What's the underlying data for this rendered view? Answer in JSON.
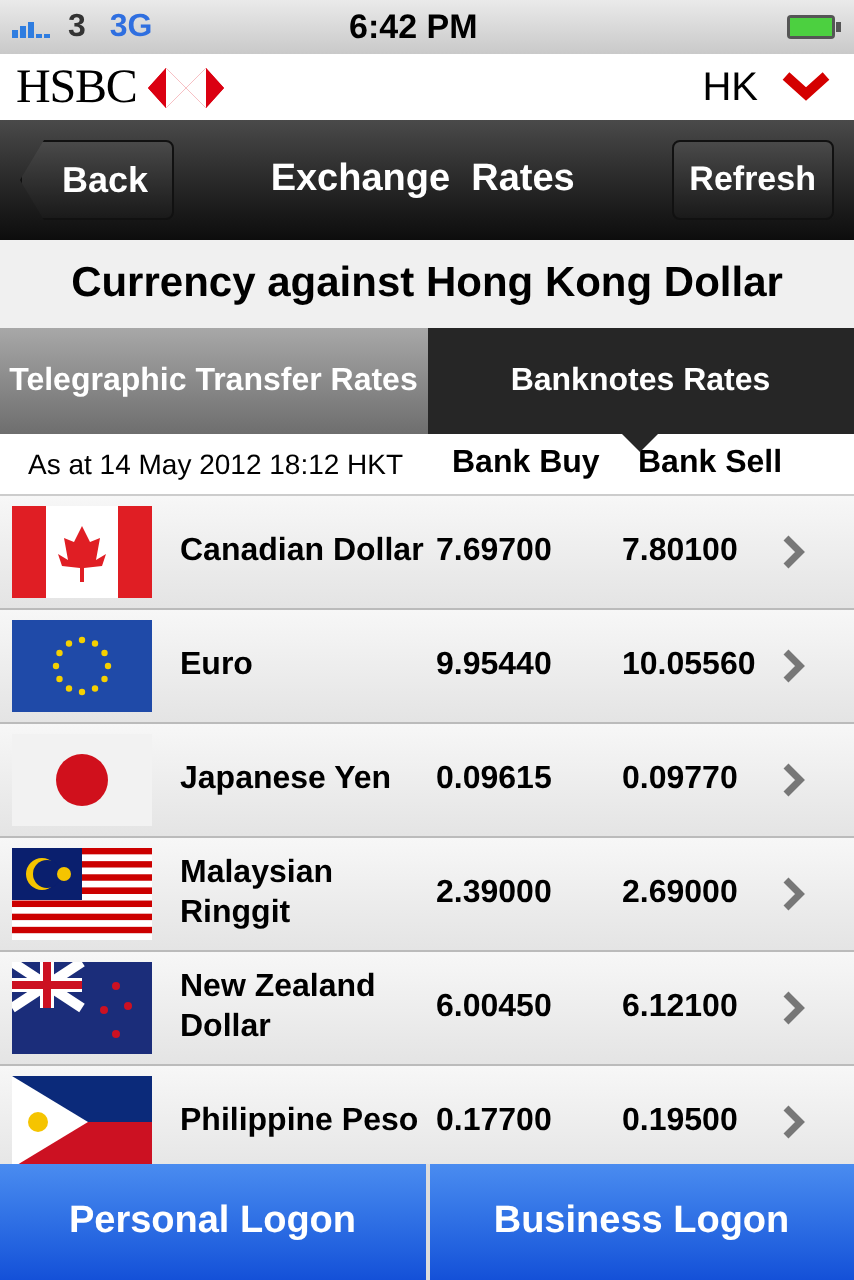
{
  "status_bar": {
    "carrier": "3",
    "network": "3G",
    "time": "6:42 PM"
  },
  "header": {
    "brand": "HSBC",
    "region": "HK"
  },
  "nav_bar": {
    "back": "Back",
    "title": "Exchange  Rates",
    "action": "Refresh"
  },
  "heading": "Currency against Hong Kong Dollar",
  "tabs": [
    {
      "label": "Telegraphic Transfer Rates",
      "selected": false
    },
    {
      "label": "Banknotes Rates",
      "selected": true
    }
  ],
  "table": {
    "timestamp": "As at 14 May 2012 18:12 HKT",
    "columns": [
      "Bank Buy",
      "Bank Sell"
    ],
    "rows": [
      {
        "currency": "Canadian Dollar",
        "buy": "7.69700",
        "sell": "7.80100"
      },
      {
        "currency": "Euro",
        "buy": "9.95440",
        "sell": "10.05560"
      },
      {
        "currency": "Japanese Yen",
        "buy": "0.09615",
        "sell": "0.09770"
      },
      {
        "currency": "Malaysian Ringgit",
        "buy": "2.39000",
        "sell": "2.69000"
      },
      {
        "currency": "New Zealand Dollar",
        "buy": "6.00450",
        "sell": "6.12100"
      },
      {
        "currency": "Philippine Peso",
        "buy": "0.17700",
        "sell": "0.19500"
      }
    ]
  },
  "footer_buttons": [
    "Personal Logon",
    "Business Logon"
  ]
}
